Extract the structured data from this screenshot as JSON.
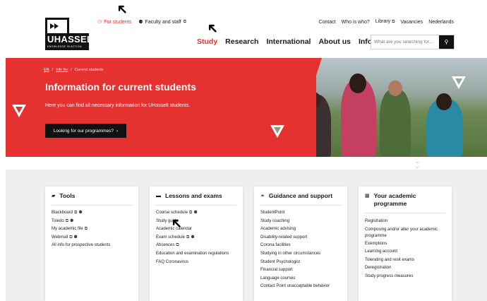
{
  "header": {
    "logo_text": "UHASSELT",
    "logo_tagline": "KNOWLEDGE IN ACTION",
    "audience_links": [
      {
        "label": "For students",
        "icon": "student-icon",
        "active": true
      },
      {
        "label": "Faculty and staff",
        "icon": "staff-icon",
        "external": true
      }
    ],
    "utility_links": [
      "Contact",
      "Who is who?",
      "Library",
      "Vacancies",
      "Nederlands"
    ],
    "main_nav": [
      {
        "label": "Study",
        "active": true
      },
      {
        "label": "Research"
      },
      {
        "label": "International"
      },
      {
        "label": "About us"
      },
      {
        "label": "Info for"
      }
    ],
    "search_placeholder": "What are you searching for..."
  },
  "hero": {
    "breadcrumb": [
      "EN",
      "Info for",
      "Current students"
    ],
    "title": "Information for current students",
    "subtitle": "Here you can find all necessary information for UHasselt students.",
    "button_label": "Looking for our programmes?"
  },
  "cards": [
    {
      "title": "Tools",
      "icon": "toolbox-icon",
      "items": [
        {
          "label": "Blackboard",
          "ext": true,
          "people": true
        },
        {
          "label": "Toledo",
          "ext": true,
          "people": true
        },
        {
          "label": "My academic file",
          "ext": true
        },
        {
          "label": "Webmail",
          "ext": true,
          "people": true
        },
        {
          "label": "All info for prospective students"
        }
      ]
    },
    {
      "title": "Lessons and exams",
      "icon": "briefcase-icon",
      "items": [
        {
          "label": "Course schedule",
          "ext": true,
          "people": true
        },
        {
          "label": "Study guide"
        },
        {
          "label": "Academic calendar"
        },
        {
          "label": "Exam schedule",
          "ext": true,
          "people": true
        },
        {
          "label": "Absences",
          "ext": true
        },
        {
          "label": "Education and examination regulations"
        },
        {
          "label": "FAQ Coronavirus"
        }
      ]
    },
    {
      "title": "Guidance and support",
      "icon": "leaf-icon",
      "items": [
        {
          "label": "StudentPoint"
        },
        {
          "label": "Study coaching"
        },
        {
          "label": "Academic advising"
        },
        {
          "label": "Disability-related support"
        },
        {
          "label": "Corona facilities"
        },
        {
          "label": "Studying in other circumstances"
        },
        {
          "label": "Student Psychologist"
        },
        {
          "label": "Financial support"
        },
        {
          "label": "Language courses"
        },
        {
          "label": "Contact Point unacceptable behavior"
        }
      ]
    },
    {
      "title": "Your academic programme",
      "icon": "calendar-icon",
      "items": [
        {
          "label": "Registration"
        },
        {
          "label": "Composing and/or alter your academic programme"
        },
        {
          "label": "Exemptions"
        },
        {
          "label": "Learning account"
        },
        {
          "label": "Tolerating and resit exams"
        },
        {
          "label": "Deregistration"
        },
        {
          "label": "Study progress measures"
        }
      ]
    }
  ],
  "colors": {
    "accent": "#e5312f",
    "dark": "#111111",
    "grey_bg": "#efefef"
  }
}
